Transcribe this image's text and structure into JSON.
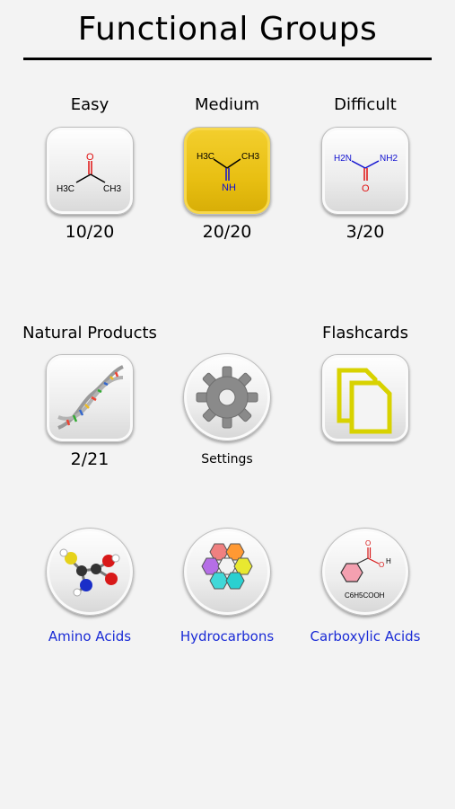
{
  "header": {
    "title": "Functional Groups"
  },
  "levels": [
    {
      "label": "Easy",
      "score": "10/20",
      "icon": "acetone-structure-icon",
      "chem": {
        "o": "O",
        "left": "H3C",
        "right": "CH3"
      }
    },
    {
      "label": "Medium",
      "score": "20/20",
      "icon": "imine-structure-icon",
      "chem": {
        "left": "H3C",
        "right": "CH3",
        "bottom": "NH"
      }
    },
    {
      "label": "Difficult",
      "score": "3/20",
      "icon": "urea-structure-icon",
      "chem": {
        "left": "H2N",
        "right": "NH2",
        "o": "O"
      }
    }
  ],
  "natural_products": {
    "label": "Natural Products",
    "score": "2/21",
    "icon": "dna-helix-icon"
  },
  "settings": {
    "label": "Settings",
    "icon": "gear-icon"
  },
  "flashcards": {
    "label": "Flashcards",
    "icon": "documents-icon"
  },
  "categories": [
    {
      "label": "Amino Acids",
      "icon": "amino-acid-molecule-icon"
    },
    {
      "label": "Hydrocarbons",
      "icon": "polycyclic-hydrocarbon-icon"
    },
    {
      "label": "Carboxylic Acids",
      "icon": "benzoic-acid-icon",
      "formula": "C6H5COOH",
      "o": "O",
      "h": "H"
    }
  ],
  "colors": {
    "background": "#f3f3f3",
    "gold_tile": "#e8bf12",
    "link": "#1a2bd6",
    "oxygen": "#e01010",
    "nitrogen": "#1010d0"
  }
}
